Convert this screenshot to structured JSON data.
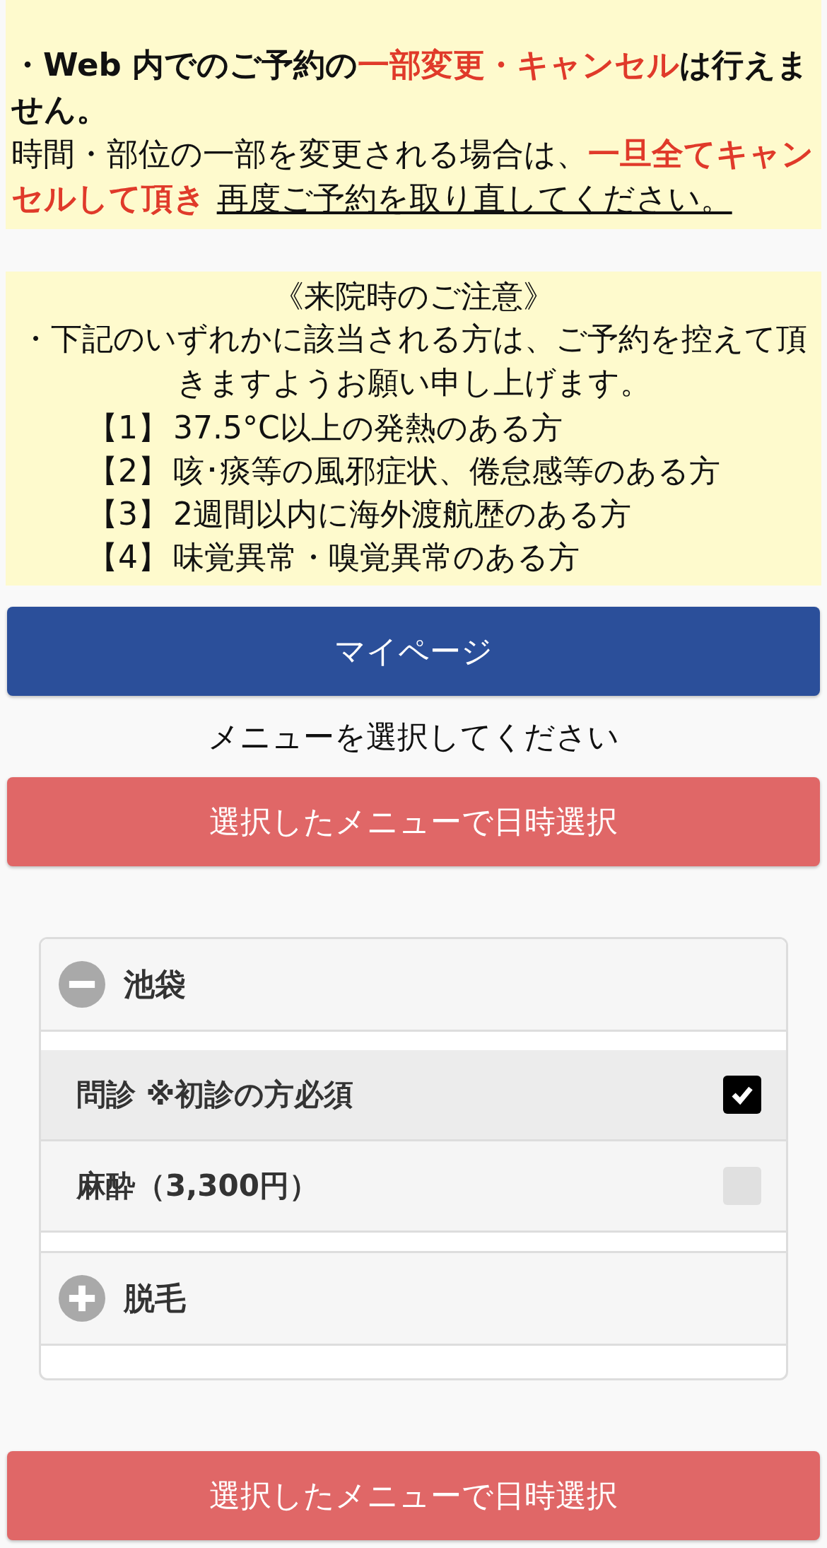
{
  "payment_notice": {
    "paragraphs": [
      {
        "kind": "bold",
        "segments": [
          {
            "text": "・Web 内でのご予約の",
            "kind": "plain"
          },
          {
            "text": "一部変更・キャンセル",
            "kind": "emphasis"
          },
          {
            "text": "は行えません。",
            "kind": "plain"
          }
        ]
      },
      {
        "kind": "normal",
        "segments": [
          {
            "text": "時間・部位の一部を変更される場合は、",
            "kind": "plain"
          },
          {
            "text": "一旦全てキャンセルして頂き ",
            "kind": "emphasis"
          },
          {
            "text": "再度ご予約を取り直してください。",
            "kind": "link"
          }
        ]
      }
    ]
  },
  "visit_notice": {
    "title": "《来院時のご注意》",
    "intro": "・下記のいずれかに該当される方は、ご予約を控えて頂きますようお願い申し上げます。",
    "items": [
      {
        "number": "【1】",
        "text": "37.5°C以上の発熱のある方"
      },
      {
        "number": "【2】",
        "text": "咳･痰等の風邪症状、倦怠感等のある方"
      },
      {
        "number": "【3】",
        "text": "2週間以内に海外渡航歴のある方"
      },
      {
        "number": "【4】",
        "text": "味覚異常・嗅覚異常のある方"
      }
    ]
  },
  "mypage_button": "マイページ",
  "prompt": "メニューを選択してください",
  "date_button_top": "選択したメニューで日時選択",
  "menu_groups": [
    {
      "title": "池袋",
      "expanded": true,
      "options": [
        {
          "label": "問診 ※初診の方必須",
          "checked": true
        },
        {
          "label": "麻酔（3,300円）",
          "checked": false
        }
      ]
    },
    {
      "title": "脱毛",
      "expanded": false
    }
  ],
  "date_button_bottom": "選択したメニューで日時選択"
}
